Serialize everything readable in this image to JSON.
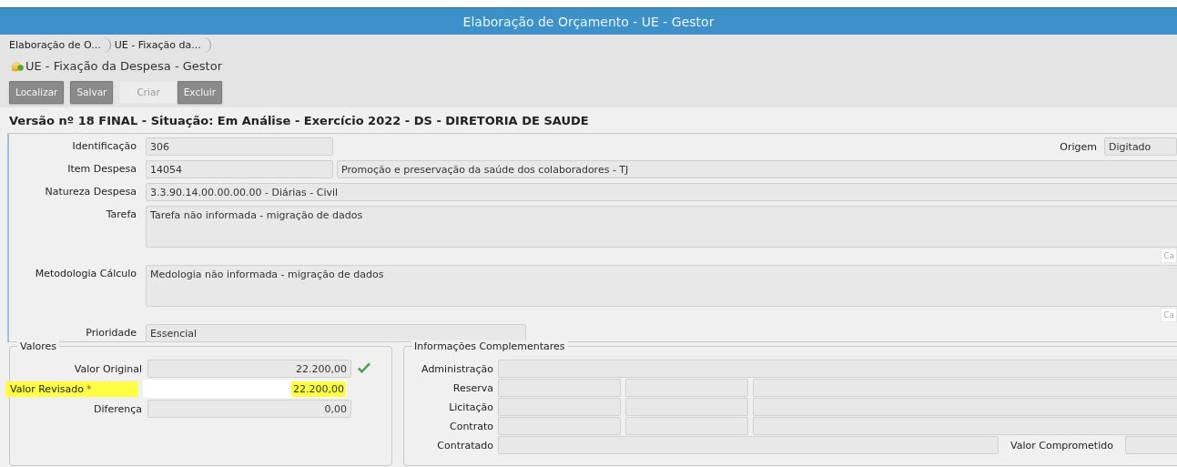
{
  "window": {
    "title": "Elaboração de Orçamento - UE - Gestor"
  },
  "breadcrumbs": [
    {
      "label": "Elaboração de O..."
    },
    {
      "label": "UE - Fixação da..."
    }
  ],
  "page_title": "UE - Fixação da Despesa - Gestor",
  "toolbar": [
    {
      "label": "Localizar",
      "disabled": false
    },
    {
      "label": "Salvar",
      "disabled": false
    },
    {
      "label": "Criar",
      "disabled": true
    },
    {
      "label": "Excluir",
      "disabled": false
    }
  ],
  "heading": "Versão nº 18 FINAL - Situação: Em Análise - Exercício 2022 - DS - DIRETORIA DE SAUDE",
  "form": {
    "identificacao": {
      "label": "Identificação",
      "value": "306"
    },
    "origem": {
      "label": "Origem",
      "value": "Digitado"
    },
    "item_despesa": {
      "label": "Item Despesa",
      "code": "14054",
      "description": "Promoção e preservação da saúde dos colaboradores - TJ"
    },
    "natureza": {
      "label": "Natureza Despesa",
      "value": "3.3.90.14.00.00.00.00 - Diárias - Civil"
    },
    "tarefa": {
      "label": "Tarefa",
      "value": "Tarefa não informada - migração de dados",
      "counter": "Ca"
    },
    "metodologia": {
      "label": "Metodologia Cálculo",
      "value": "Medologia não informada - migração de dados",
      "counter": "Ca"
    },
    "prioridade": {
      "label": "Prioridade",
      "value": "Essencial"
    }
  },
  "valores": {
    "legend": "Valores",
    "rows": [
      {
        "label": "Valor Original",
        "value": "22.200,00",
        "valid": true,
        "highlighted": false,
        "editable": false
      },
      {
        "label": "Valor Revisado",
        "value": "22.200,00",
        "valid": false,
        "required_mark": "*",
        "highlighted": true,
        "editable": true
      },
      {
        "label": "Diferença",
        "value": "0,00",
        "valid": false,
        "highlighted": false,
        "editable": false
      }
    ]
  },
  "complementares": {
    "legend": "Informações Complementares",
    "rows": [
      {
        "label": "Administração",
        "kind": "single"
      },
      {
        "label": "Reserva",
        "kind": "triple"
      },
      {
        "label": "Licitação",
        "kind": "triple"
      },
      {
        "label": "Contrato",
        "kind": "triple"
      }
    ],
    "contratado": {
      "label": "Contratado"
    },
    "comprometido": {
      "label": "Valor Comprometido"
    }
  }
}
